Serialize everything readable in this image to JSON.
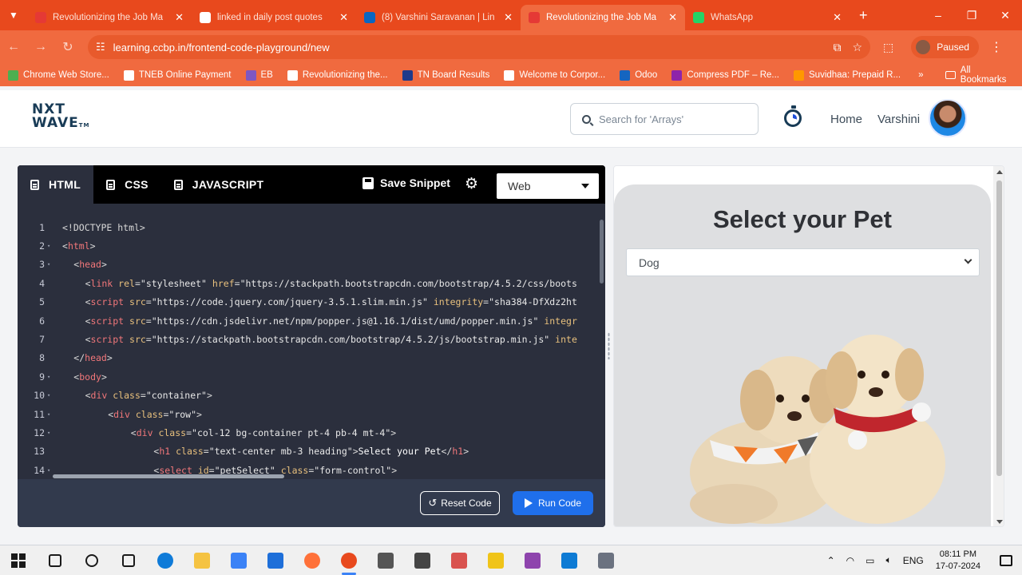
{
  "browser": {
    "tabs": [
      {
        "title": "Revolutionizing the Job Ma",
        "active": false,
        "favicon_color": "#e53935"
      },
      {
        "title": "linked in daily post quotes",
        "active": false,
        "favicon_color": "#ffffff"
      },
      {
        "title": "(8) Varshini Saravanan | Lin",
        "active": false,
        "favicon_color": "#0a66c2"
      },
      {
        "title": "Revolutionizing the Job Ma",
        "active": true,
        "favicon_color": "#e53935"
      },
      {
        "title": "WhatsApp",
        "active": false,
        "favicon_color": "#25d366"
      }
    ],
    "url": "learning.ccbp.in/frontend-code-playground/new",
    "profile_status": "Paused",
    "bookmarks": [
      "Chrome Web Store...",
      "TNEB Online Payment",
      "EB",
      "Revolutionizing the...",
      "TN Board Results",
      "Welcome to Corpor...",
      "Odoo",
      "Compress PDF – Re...",
      "Suvidhaa: Prepaid R..."
    ],
    "all_bookmarks": "All Bookmarks"
  },
  "site": {
    "logo_line1": "NXT",
    "logo_line2": "WAVE",
    "logo_tm": "TM",
    "search_placeholder": "Search for 'Arrays'",
    "nav_home": "Home",
    "user_name": "Varshini"
  },
  "editor": {
    "tabs": [
      "HTML",
      "CSS",
      "JAVASCRIPT"
    ],
    "active_tab": "HTML",
    "save_label": "Save Snippet",
    "mode": "Web",
    "reset_label": "Reset Code",
    "run_label": "Run Code",
    "lines": [
      {
        "n": "1",
        "fold": false,
        "indent": 0,
        "tokens": [
          [
            "punc",
            "<!DOCTYPE html>"
          ]
        ]
      },
      {
        "n": "2",
        "fold": true,
        "indent": 0,
        "tokens": [
          [
            "punc",
            "<"
          ],
          [
            "tag",
            "html"
          ],
          [
            "punc",
            ">"
          ]
        ]
      },
      {
        "n": "3",
        "fold": true,
        "indent": 2,
        "tokens": [
          [
            "punc",
            "<"
          ],
          [
            "tag",
            "head"
          ],
          [
            "punc",
            ">"
          ]
        ]
      },
      {
        "n": "4",
        "fold": false,
        "indent": 4,
        "tokens": [
          [
            "punc",
            "<"
          ],
          [
            "tag",
            "link"
          ],
          [
            "punc",
            " "
          ],
          [
            "attr",
            "rel"
          ],
          [
            "punc",
            "="
          ],
          [
            "str",
            "\"stylesheet\""
          ],
          [
            "punc",
            " "
          ],
          [
            "attr",
            "href"
          ],
          [
            "punc",
            "="
          ],
          [
            "str",
            "\"https://stackpath.bootstrapcdn.com/bootstrap/4.5.2/css/boots"
          ]
        ]
      },
      {
        "n": "5",
        "fold": false,
        "indent": 4,
        "tokens": [
          [
            "punc",
            "<"
          ],
          [
            "tag",
            "script"
          ],
          [
            "punc",
            " "
          ],
          [
            "attr",
            "src"
          ],
          [
            "punc",
            "="
          ],
          [
            "str",
            "\"https://code.jquery.com/jquery-3.5.1.slim.min.js\""
          ],
          [
            "punc",
            " "
          ],
          [
            "attr",
            "integrity"
          ],
          [
            "punc",
            "="
          ],
          [
            "str",
            "\"sha384-DfXdz2ht"
          ]
        ]
      },
      {
        "n": "6",
        "fold": false,
        "indent": 4,
        "tokens": [
          [
            "punc",
            "<"
          ],
          [
            "tag",
            "script"
          ],
          [
            "punc",
            " "
          ],
          [
            "attr",
            "src"
          ],
          [
            "punc",
            "="
          ],
          [
            "str",
            "\"https://cdn.jsdelivr.net/npm/popper.js@1.16.1/dist/umd/popper.min.js\""
          ],
          [
            "punc",
            " "
          ],
          [
            "attr",
            "integr"
          ]
        ]
      },
      {
        "n": "7",
        "fold": false,
        "indent": 4,
        "tokens": [
          [
            "punc",
            "<"
          ],
          [
            "tag",
            "script"
          ],
          [
            "punc",
            " "
          ],
          [
            "attr",
            "src"
          ],
          [
            "punc",
            "="
          ],
          [
            "str",
            "\"https://stackpath.bootstrapcdn.com/bootstrap/4.5.2/js/bootstrap.min.js\""
          ],
          [
            "punc",
            " "
          ],
          [
            "attr",
            "inte"
          ]
        ]
      },
      {
        "n": "8",
        "fold": false,
        "indent": 2,
        "tokens": [
          [
            "punc",
            "</"
          ],
          [
            "tag",
            "head"
          ],
          [
            "punc",
            ">"
          ]
        ]
      },
      {
        "n": "9",
        "fold": true,
        "indent": 2,
        "tokens": [
          [
            "punc",
            "<"
          ],
          [
            "tag",
            "body"
          ],
          [
            "punc",
            ">"
          ]
        ]
      },
      {
        "n": "10",
        "fold": true,
        "indent": 4,
        "tokens": [
          [
            "punc",
            "<"
          ],
          [
            "tag",
            "div"
          ],
          [
            "punc",
            " "
          ],
          [
            "attr",
            "class"
          ],
          [
            "punc",
            "="
          ],
          [
            "str",
            "\"container\""
          ],
          [
            "punc",
            ">"
          ]
        ]
      },
      {
        "n": "11",
        "fold": true,
        "indent": 8,
        "tokens": [
          [
            "punc",
            "<"
          ],
          [
            "tag",
            "div"
          ],
          [
            "punc",
            " "
          ],
          [
            "attr",
            "class"
          ],
          [
            "punc",
            "="
          ],
          [
            "str",
            "\"row\""
          ],
          [
            "punc",
            ">"
          ]
        ]
      },
      {
        "n": "12",
        "fold": true,
        "indent": 12,
        "tokens": [
          [
            "punc",
            "<"
          ],
          [
            "tag",
            "div"
          ],
          [
            "punc",
            " "
          ],
          [
            "attr",
            "class"
          ],
          [
            "punc",
            "="
          ],
          [
            "str",
            "\"col-12 bg-container pt-4 pb-4 mt-4\""
          ],
          [
            "punc",
            ">"
          ]
        ]
      },
      {
        "n": "13",
        "fold": false,
        "indent": 16,
        "tokens": [
          [
            "punc",
            "<"
          ],
          [
            "tag",
            "h1"
          ],
          [
            "punc",
            " "
          ],
          [
            "attr",
            "class"
          ],
          [
            "punc",
            "="
          ],
          [
            "str",
            "\"text-center mb-3 heading\""
          ],
          [
            "punc",
            ">"
          ],
          [
            "text",
            "Select your Pet"
          ],
          [
            "punc",
            "</"
          ],
          [
            "tag",
            "h1"
          ],
          [
            "punc",
            ">"
          ]
        ]
      },
      {
        "n": "14",
        "fold": true,
        "indent": 16,
        "tokens": [
          [
            "punc",
            "<"
          ],
          [
            "tag",
            "select"
          ],
          [
            "punc",
            " "
          ],
          [
            "attr",
            "id"
          ],
          [
            "punc",
            "="
          ],
          [
            "str",
            "\"petSelect\""
          ],
          [
            "punc",
            " "
          ],
          [
            "attr",
            "class"
          ],
          [
            "punc",
            "="
          ],
          [
            "str",
            "\"form-control\""
          ],
          [
            "punc",
            ">"
          ]
        ]
      }
    ]
  },
  "preview": {
    "heading": "Select your Pet",
    "selected_pet": "Dog"
  },
  "taskbar": {
    "language": "ENG",
    "time": "08:11 PM",
    "date": "17-07-2024",
    "apps": [
      {
        "name": "search",
        "color": "#1a1a1a"
      },
      {
        "name": "cortana",
        "color": "#1a1a1a"
      },
      {
        "name": "task-view",
        "color": "#1a1a1a"
      },
      {
        "name": "edge",
        "color": "#0f7bd8"
      },
      {
        "name": "file-explorer",
        "color": "#f5c342"
      },
      {
        "name": "store",
        "color": "#3b82f6"
      },
      {
        "name": "mail",
        "color": "#1e6fd9"
      },
      {
        "name": "firefox",
        "color": "#ff7139"
      },
      {
        "name": "chrome",
        "color": "#e8491d"
      },
      {
        "name": "app-generic",
        "color": "#555555"
      },
      {
        "name": "app-mw",
        "color": "#444444"
      },
      {
        "name": "app-paint",
        "color": "#d9534f"
      },
      {
        "name": "app-yellow",
        "color": "#f0c419"
      },
      {
        "name": "visual-studio",
        "color": "#8e44ad"
      },
      {
        "name": "vscode",
        "color": "#0e7bd4"
      },
      {
        "name": "app-sketch",
        "color": "#6b7280"
      }
    ]
  }
}
